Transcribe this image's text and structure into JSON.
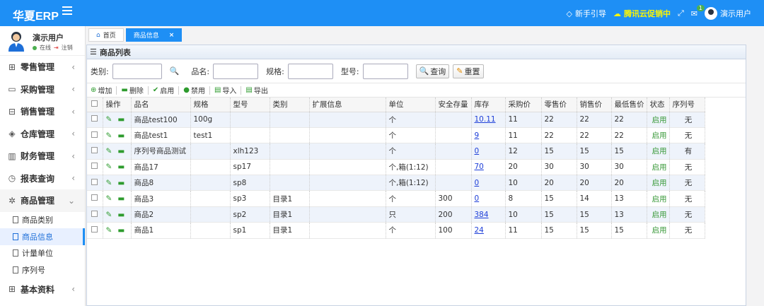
{
  "header": {
    "brand": "华夏ERP",
    "guide": "新手引导",
    "promo": "腾讯云促销中",
    "msg_count": "1",
    "user": "演示用户"
  },
  "sidebar": {
    "user": {
      "name": "演示用户",
      "online": "在线",
      "logout": "注销"
    },
    "items": [
      {
        "label": "零售管理",
        "icon": "gift-icon"
      },
      {
        "label": "采购管理",
        "icon": "monitor-icon"
      },
      {
        "label": "销售管理",
        "icon": "briefcase-icon"
      },
      {
        "label": "仓库管理",
        "icon": "layers-icon"
      },
      {
        "label": "财务管理",
        "icon": "book-icon"
      },
      {
        "label": "报表查询",
        "icon": "clock-icon"
      },
      {
        "label": "商品管理",
        "icon": "settings-icon"
      }
    ],
    "subitems": [
      "商品类别",
      "商品信息",
      "计量单位",
      "序列号"
    ],
    "bottom": {
      "label": "基本资料",
      "icon": "grid-icon"
    }
  },
  "tabs": [
    {
      "label": "首页"
    },
    {
      "label": "商品信息"
    }
  ],
  "panel": {
    "title": "商品列表"
  },
  "search": {
    "category": "类别:",
    "name": "品名:",
    "spec": "规格:",
    "model": "型号:",
    "query": "查询",
    "reset": "重置"
  },
  "toolbar": {
    "add": "增加",
    "delete": "删除",
    "enable": "启用",
    "disable": "禁用",
    "import": "导入",
    "export": "导出"
  },
  "table": {
    "headers": [
      "操作",
      "品名",
      "规格",
      "型号",
      "类别",
      "扩展信息",
      "单位",
      "安全存量",
      "库存",
      "采购价",
      "零售价",
      "销售价",
      "最低售价",
      "状态",
      "序列号"
    ],
    "rows": [
      {
        "name": "商品test100",
        "spec": "100g",
        "model": "",
        "category": "",
        "ext": "",
        "unit": "个",
        "safe": "",
        "stock": "10.11",
        "buy": "11",
        "retail": "22",
        "sale": "22",
        "min": "22",
        "status": "启用",
        "serial": "无"
      },
      {
        "name": "商品test1",
        "spec": "test1",
        "model": "",
        "category": "",
        "ext": "",
        "unit": "个",
        "safe": "",
        "stock": "9",
        "buy": "11",
        "retail": "22",
        "sale": "22",
        "min": "22",
        "status": "启用",
        "serial": "无"
      },
      {
        "name": "序列号商品测试",
        "spec": "",
        "model": "xlh123",
        "category": "",
        "ext": "",
        "unit": "个",
        "safe": "",
        "stock": "0",
        "buy": "12",
        "retail": "15",
        "sale": "15",
        "min": "15",
        "status": "启用",
        "serial": "有"
      },
      {
        "name": "商品17",
        "spec": "",
        "model": "sp17",
        "category": "",
        "ext": "",
        "unit": "个,箱(1:12)",
        "safe": "",
        "stock": "70",
        "buy": "20",
        "retail": "30",
        "sale": "30",
        "min": "30",
        "status": "启用",
        "serial": "无"
      },
      {
        "name": "商品8",
        "spec": "",
        "model": "sp8",
        "category": "",
        "ext": "",
        "unit": "个,箱(1:12)",
        "safe": "",
        "stock": "0",
        "buy": "10",
        "retail": "20",
        "sale": "20",
        "min": "20",
        "status": "启用",
        "serial": "无"
      },
      {
        "name": "商品3",
        "spec": "",
        "model": "sp3",
        "category": "目录1",
        "ext": "",
        "unit": "个",
        "safe": "300",
        "stock": "0",
        "buy": "8",
        "retail": "15",
        "sale": "14",
        "min": "13",
        "status": "启用",
        "serial": "无"
      },
      {
        "name": "商品2",
        "spec": "",
        "model": "sp2",
        "category": "目录1",
        "ext": "",
        "unit": "只",
        "safe": "200",
        "stock": "384",
        "buy": "10",
        "retail": "15",
        "sale": "15",
        "min": "13",
        "status": "启用",
        "serial": "无"
      },
      {
        "name": "商品1",
        "spec": "",
        "model": "sp1",
        "category": "目录1",
        "ext": "",
        "unit": "个",
        "safe": "100",
        "stock": "24",
        "buy": "11",
        "retail": "15",
        "sale": "15",
        "min": "15",
        "status": "启用",
        "serial": "无"
      }
    ]
  },
  "colors": {
    "primary": "#1e8ff5",
    "enabled": "#3a9a3a",
    "link": "#1e3fd8"
  }
}
